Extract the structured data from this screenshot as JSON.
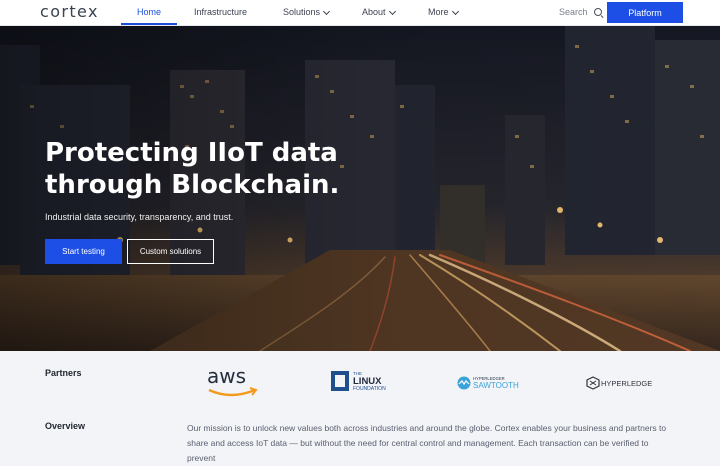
{
  "brand": {
    "logo_text": "cortex"
  },
  "nav": {
    "items": [
      {
        "label": "Home",
        "active": true,
        "has_dropdown": false
      },
      {
        "label": "Infrastructure",
        "active": false,
        "has_dropdown": false
      },
      {
        "label": "Solutions",
        "active": false,
        "has_dropdown": true
      },
      {
        "label": "About",
        "active": false,
        "has_dropdown": true
      },
      {
        "label": "More",
        "active": false,
        "has_dropdown": true
      }
    ],
    "search_label": "Search",
    "platform_label": "Platform"
  },
  "hero": {
    "title": "Protecting IIoT data through Blockchain.",
    "subtitle": "Industrial data security, transparency, and trust.",
    "primary_button": "Start testing",
    "secondary_button": "Custom solutions"
  },
  "partners": {
    "label": "Partners",
    "logos": [
      {
        "name": "aws",
        "text": "aws"
      },
      {
        "name": "linux-foundation",
        "text_top": "THE",
        "text_main": "LINUX",
        "text_bottom": "FOUNDATION"
      },
      {
        "name": "hyperledger-sawtooth",
        "text_top": "HYPERLEDGER",
        "text_main": "SAWTOOTH"
      },
      {
        "name": "hyperledger",
        "text": "HYPERLEDGER"
      }
    ]
  },
  "overview": {
    "label": "Overview",
    "text": "Our mission is to unlock new values both across industries and around the globe. Cortex enables your business and partners to share and access IoT data — but without the need for central control and management. Each transaction can be verified to prevent"
  },
  "colors": {
    "accent": "#1d4fe6",
    "nav_active": "#1b4fd8",
    "page_bg": "#f3f4f7",
    "aws_orange": "#f29a1e",
    "linux_blue": "#1f4e8c",
    "sawtooth_blue": "#3aa2d8"
  }
}
